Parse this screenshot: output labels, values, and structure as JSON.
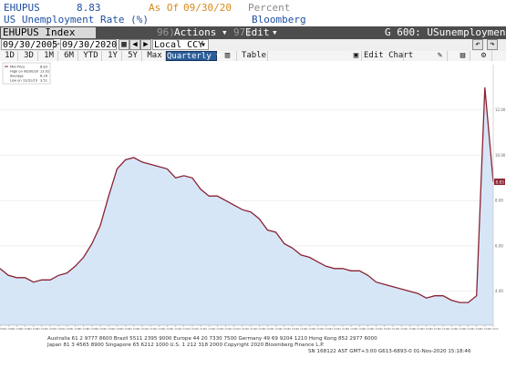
{
  "header": {
    "ticker": "EHUPUS",
    "value": "8.83",
    "as_of_label": "As Of",
    "as_of_date": "09/30/20",
    "unit": "Percent",
    "description": "US Unemployment Rate (%)",
    "source": "Bloomberg"
  },
  "titlebar": {
    "security": "EHUPUS Index",
    "actions_num": "96)",
    "actions_label": "Actions",
    "edit_num": "97)",
    "edit_label": "Edit",
    "page_title": "G 600: USunemployment"
  },
  "controls": {
    "start_date": "09/30/2005",
    "end_date": "09/30/2020",
    "currency": "Local CCY",
    "ranges": [
      "1D",
      "3D",
      "1M",
      "6M",
      "YTD",
      "1Y",
      "5Y",
      "Max"
    ],
    "period": "Quarterly",
    "table_label": "Table",
    "edit_chart_label": "Edit Chart"
  },
  "legend": [
    {
      "label": "Mid Price",
      "value": "8.83"
    },
    {
      "label": "High on 06/30/20",
      "value": "13.02"
    },
    {
      "label": "Average",
      "value": "6.26"
    },
    {
      "label": "Low on 12/31/19",
      "value": "3.51"
    }
  ],
  "last_value_label": "8.83",
  "footer": {
    "line1": "Australia 61 2 9777 8600  Brazil 5511 2395 9000  Europe 44 20 7330 7500  Germany 49 69 9204 1210  Hong Kong 852 2977 6000",
    "line2": "Japan 81 3 4565 8900        Singapore 65 6212 1000        U.S. 1 212 318 2000        Copyright 2020 Bloomberg Finance L.P.",
    "line3": "SN 168122 AST  GMT+3:00 G613-6893-0 01-Nov-2020 15:18:46"
  },
  "colors": {
    "line": "#8b2232",
    "fill": "#d6e6f7",
    "title_bar": "#4d4d4d",
    "accent_blue": "#1f4f9e",
    "accent_orange": "#d58a1e"
  },
  "chart_data": {
    "type": "area",
    "title": "",
    "xlabel": "",
    "ylabel": "",
    "ylim": [
      2.5,
      14.0
    ],
    "y_ticks": [
      "4.00",
      "6.00",
      "8.00",
      "10.00",
      "12.00"
    ],
    "x_tick_labels": [
      "Q4 2005",
      "Q1 2006",
      "Q2 2006",
      "Q3 2006",
      "Q4 2006",
      "Q1 2007",
      "Q2 2007",
      "Q3 2007",
      "Q4 2007",
      "Q1 2008",
      "Q2 2008",
      "Q3 2008",
      "Q4 2008",
      "Q1 2009",
      "Q2 2009",
      "Q3 2009",
      "Q4 2009",
      "Q1 2010",
      "Q2 2010",
      "Q3 2010",
      "Q4 2010",
      "Q1 2011",
      "Q2 2011",
      "Q3 2011",
      "Q4 2011",
      "Q1 2012",
      "Q2 2012",
      "Q3 2012",
      "Q4 2012",
      "Q1 2013",
      "Q2 2013",
      "Q3 2013",
      "Q4 2013",
      "Q1 2014",
      "Q2 2014",
      "Q3 2014",
      "Q4 2014",
      "Q1 2015",
      "Q2 2015",
      "Q3 2015",
      "Q4 2015",
      "Q1 2016",
      "Q2 2016",
      "Q3 2016",
      "Q4 2016",
      "Q1 2017",
      "Q2 2017",
      "Q3 2017",
      "Q4 2017",
      "Q1 2018",
      "Q2 2018",
      "Q3 2018",
      "Q4 2018",
      "Q1 2019",
      "Q2 2019",
      "Q3 2019",
      "Q4 2019",
      "Q1 2020",
      "Q2 2020",
      "Q3 2020"
    ],
    "series": [
      {
        "name": "Mid Price",
        "values": [
          5.0,
          4.7,
          4.6,
          4.6,
          4.4,
          4.5,
          4.5,
          4.7,
          4.8,
          5.1,
          5.5,
          6.1,
          6.9,
          8.2,
          9.4,
          9.8,
          9.9,
          9.7,
          9.6,
          9.5,
          9.4,
          9.0,
          9.1,
          9.0,
          8.5,
          8.2,
          8.2,
          8.0,
          7.8,
          7.6,
          7.5,
          7.2,
          6.7,
          6.6,
          6.1,
          5.9,
          5.6,
          5.5,
          5.3,
          5.1,
          5.0,
          5.0,
          4.9,
          4.9,
          4.7,
          4.4,
          4.3,
          4.2,
          4.1,
          4.0,
          3.9,
          3.7,
          3.8,
          3.8,
          3.6,
          3.5,
          3.5,
          3.8,
          13.0,
          8.83
        ]
      }
    ]
  }
}
